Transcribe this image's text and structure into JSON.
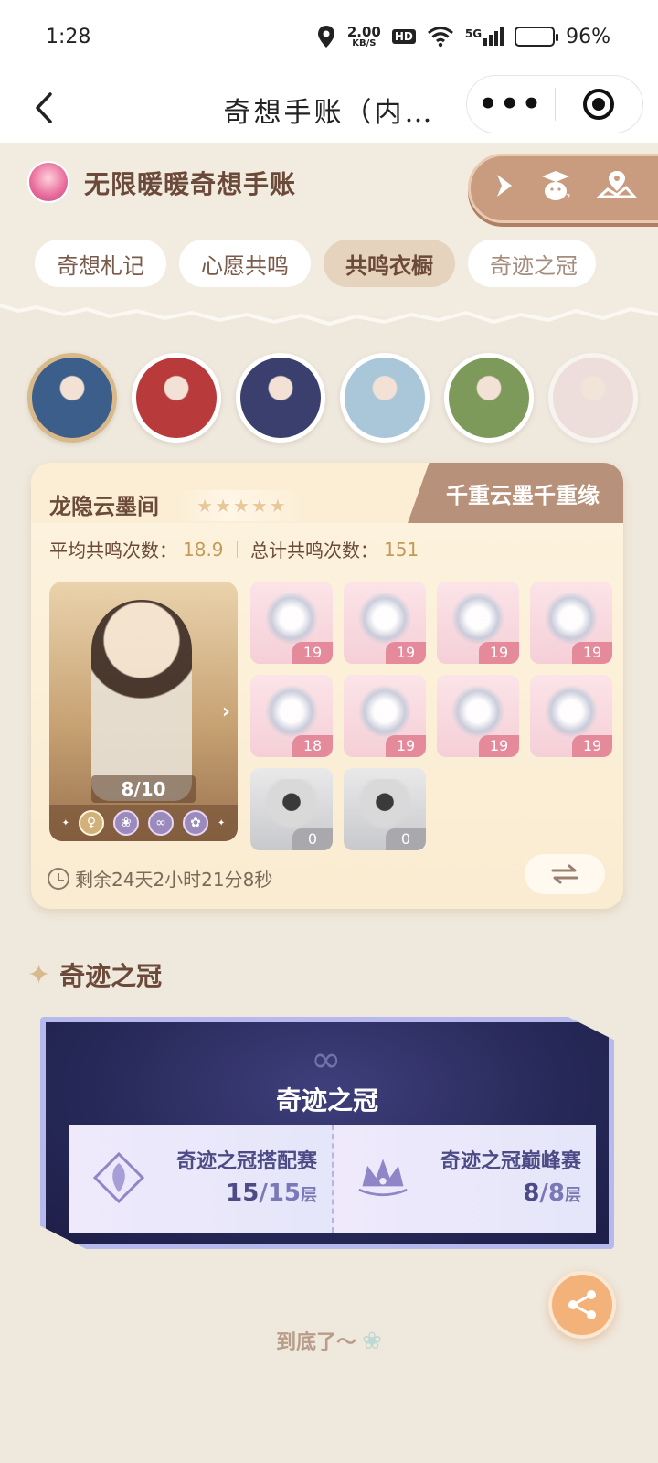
{
  "status_bar": {
    "time": "1:28",
    "net_speed": "2.00",
    "net_unit": "KB/S",
    "hd": "HD",
    "signal": "5G",
    "battery": "96%",
    "battery_level": 0.96
  },
  "nav": {
    "title": "奇想手账（内…",
    "more": "•••"
  },
  "header": {
    "app_title": "无限暖暖奇想手账",
    "tabs": [
      {
        "label": "奇想札记",
        "active": false
      },
      {
        "label": "心愿共鸣",
        "active": false
      },
      {
        "label": "共鸣衣橱",
        "active": true
      },
      {
        "label": "奇迹之冠",
        "active": false
      }
    ]
  },
  "characters": {
    "count": 6,
    "selected_index": 0,
    "colors": [
      "#3b5f8a",
      "#b83a3a",
      "#3a3f6e",
      "#a9c7d9",
      "#7d9a5a",
      "#ecd7dc"
    ]
  },
  "card": {
    "name": "龙隐云墨间",
    "stars": 5,
    "banner": "千重云墨千重缘",
    "avg_label": "平均共鸣次数：",
    "avg_value": "18.9",
    "total_label": "总计共鸣次数：",
    "total_value": "151",
    "progress": "8/10",
    "items": [
      {
        "count": "19",
        "grey": false
      },
      {
        "count": "19",
        "grey": false
      },
      {
        "count": "19",
        "grey": false
      },
      {
        "count": "19",
        "grey": false
      },
      {
        "count": "18",
        "grey": false
      },
      {
        "count": "19",
        "grey": false
      },
      {
        "count": "19",
        "grey": false
      },
      {
        "count": "19",
        "grey": false
      },
      {
        "count": "0",
        "grey": true
      },
      {
        "count": "0",
        "grey": true
      }
    ],
    "timer": "剩余24天2小时21分8秒"
  },
  "crown": {
    "section_title": "奇迹之冠",
    "card_title": "奇迹之冠",
    "left": {
      "label": "奇迹之冠搭配赛",
      "current": "15",
      "total": "15",
      "unit": "层"
    },
    "right": {
      "label": "奇迹之冠巅峰赛",
      "current": "8",
      "total": "8",
      "unit": "层"
    }
  },
  "footer": {
    "text": "到底了～"
  }
}
